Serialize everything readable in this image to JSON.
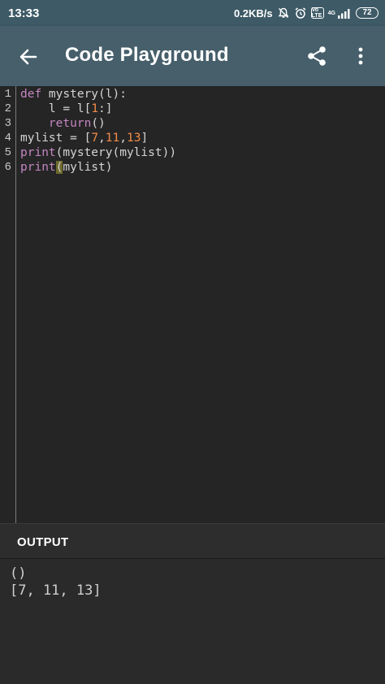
{
  "status_bar": {
    "time": "13:33",
    "network_speed": "0.2KB/s",
    "network_type": "4G",
    "lte_label": "Vo LTE",
    "battery_level": "72",
    "icons": [
      "mute-bell-icon",
      "alarm-icon",
      "volte-icon",
      "signal-icon",
      "battery-icon"
    ]
  },
  "app_bar": {
    "title": "Code Playground",
    "color": "#465f6b",
    "icons": [
      "back-arrow-icon",
      "share-icon",
      "more-vert-icon"
    ]
  },
  "editor": {
    "lines": [
      {
        "number": "1"
      },
      {
        "number": "2"
      },
      {
        "number": "3"
      },
      {
        "number": "4"
      },
      {
        "number": "5"
      },
      {
        "number": "6"
      }
    ],
    "tokens": {
      "l1_def": "def",
      "l1_rest": " mystery(l):",
      "l2_pre": "    l = l[",
      "l2_num": "1",
      "l2_post": ":]",
      "l3_indent": "    ",
      "l3_return": "return",
      "l3_post": "()",
      "l4_pre": "mylist = [",
      "l4_n1": "7",
      "l4_c1": ",",
      "l4_n2": "11",
      "l4_c2": ",",
      "l4_n3": "13",
      "l4_post": "]",
      "l5_print": "print",
      "l5_post": "(mystery(mylist))",
      "l6_print": "print",
      "l6_paren": "(",
      "l6_post": "mylist)"
    },
    "keyword_color": "#c586c0",
    "number_color": "#f28c47"
  },
  "output": {
    "header": "OUTPUT",
    "lines": [
      "()",
      "[7, 11, 13]"
    ]
  }
}
